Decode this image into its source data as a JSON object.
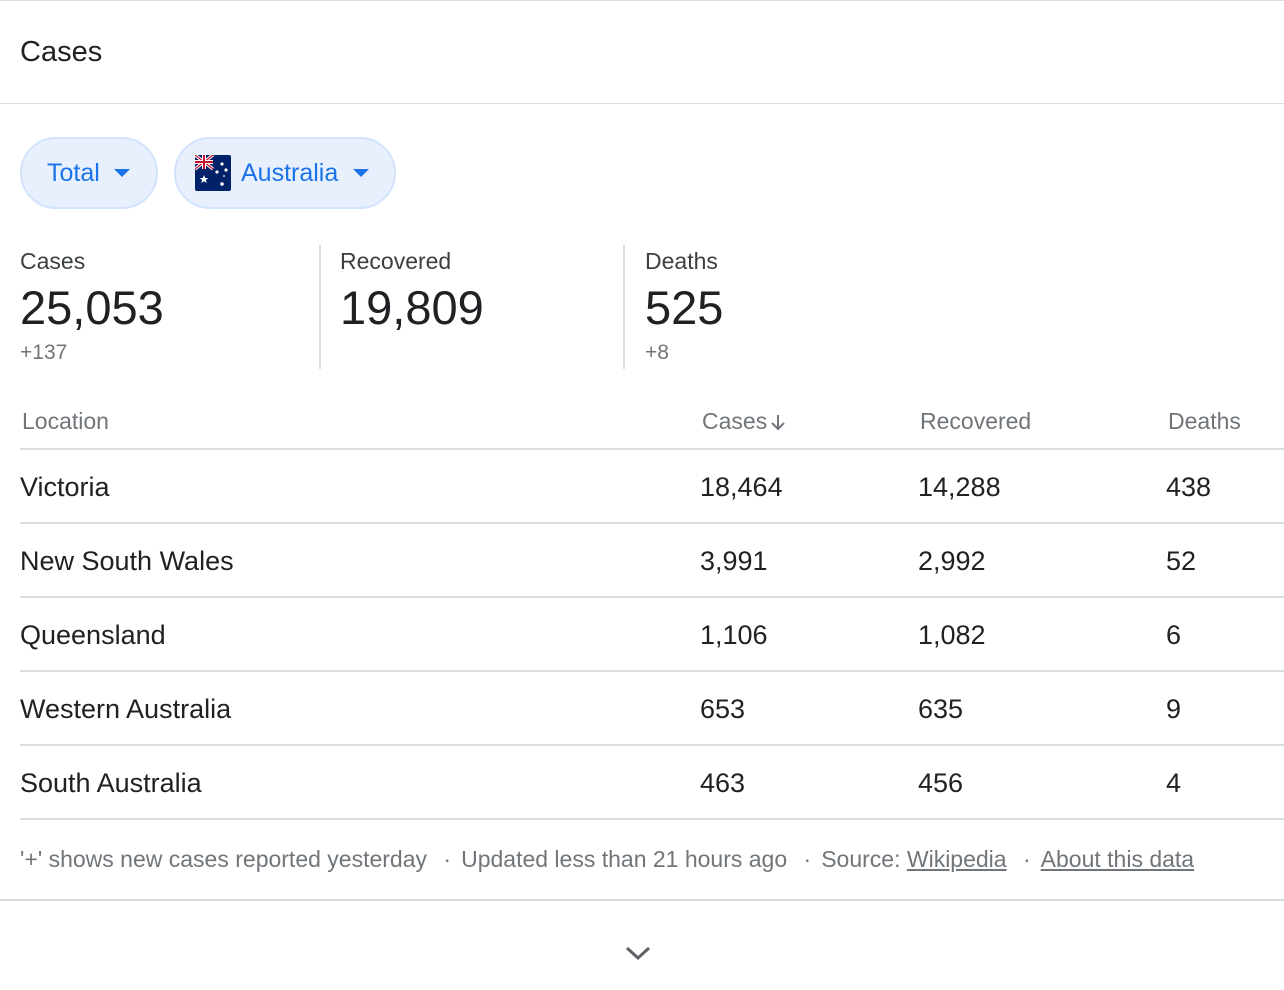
{
  "header": {
    "title": "Cases"
  },
  "filters": {
    "period": {
      "label": "Total"
    },
    "region": {
      "label": "Australia",
      "flag_icon": "australia-flag-icon"
    }
  },
  "summary": {
    "cases": {
      "label": "Cases",
      "value": "25,053",
      "delta": "+137"
    },
    "recovered": {
      "label": "Recovered",
      "value": "19,809"
    },
    "deaths": {
      "label": "Deaths",
      "value": "525",
      "delta": "+8"
    }
  },
  "table": {
    "headers": {
      "location": "Location",
      "cases": "Cases",
      "recovered": "Recovered",
      "deaths": "Deaths"
    },
    "sort": {
      "column": "cases",
      "direction": "descending",
      "icon": "arrow-down-icon"
    },
    "rows": [
      {
        "location": "Victoria",
        "cases": "18,464",
        "recovered": "14,288",
        "deaths": "438"
      },
      {
        "location": "New South Wales",
        "cases": "3,991",
        "recovered": "2,992",
        "deaths": "52"
      },
      {
        "location": "Queensland",
        "cases": "1,106",
        "recovered": "1,082",
        "deaths": "6"
      },
      {
        "location": "Western Australia",
        "cases": "653",
        "recovered": "635",
        "deaths": "9"
      },
      {
        "location": "South Australia",
        "cases": "463",
        "recovered": "456",
        "deaths": "4"
      }
    ]
  },
  "footer": {
    "note": "'+' shows new cases reported yesterday",
    "separator": "·",
    "updated": "Updated less than 21 hours ago",
    "source_label": "Source:",
    "source_link": "Wikipedia",
    "about_link": "About this data"
  },
  "expand": {
    "icon": "chevron-down-icon"
  },
  "colors": {
    "accent": "#1a73e8",
    "chip_bg": "#e8f0fe",
    "divider": "#dadce0",
    "text_primary": "#202124",
    "text_secondary": "#70757a"
  }
}
